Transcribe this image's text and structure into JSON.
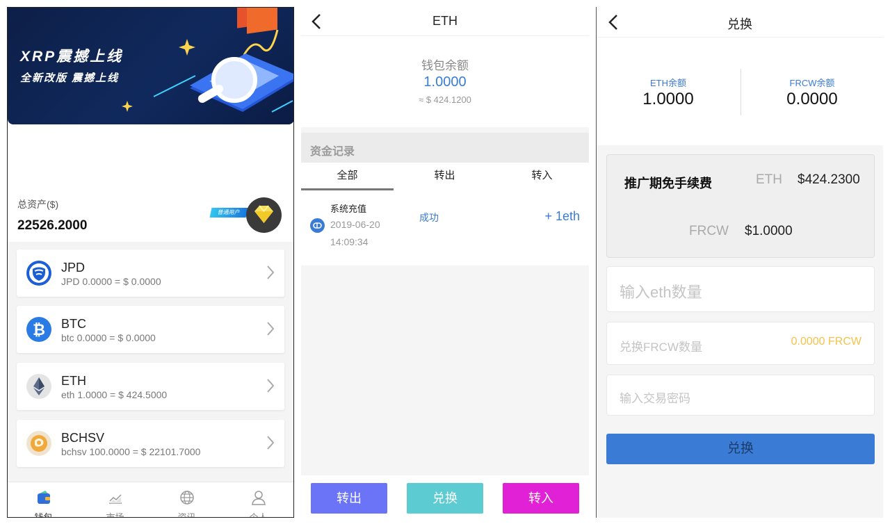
{
  "wallet": {
    "banner_title": "XRP震撼上线",
    "banner_subtitle": "全新改版  震撼上线",
    "total_assets_label": "总资产($)",
    "total_assets_value": "22526.2000",
    "user_badge": "普通用户",
    "coins": [
      {
        "name": "JPD",
        "detail": "JPD 0.0000 = $ 0.0000",
        "icon": "jpd-icon"
      },
      {
        "name": "BTC",
        "detail": "btc 0.0000 = $ 0.0000",
        "icon": "bitcoin-icon"
      },
      {
        "name": "ETH",
        "detail": "eth 1.0000 = $ 424.5000",
        "icon": "ethereum-icon"
      },
      {
        "name": "BCHSV",
        "detail": "bchsv 100.0000 = $ 22101.7000",
        "icon": "bchsv-icon"
      }
    ],
    "tabs": [
      {
        "label": "钱包",
        "icon": "wallet-icon"
      },
      {
        "label": "市场",
        "icon": "chart-icon"
      },
      {
        "label": "资讯",
        "icon": "globe-icon"
      },
      {
        "label": "个人",
        "icon": "user-icon"
      }
    ]
  },
  "eth": {
    "title": "ETH",
    "balance_label": "钱包余额",
    "balance_value": "1.0000",
    "balance_usd": "≈ $ 424.1200",
    "records_title": "资金记录",
    "record_tabs": [
      "全部",
      "转出",
      "转入"
    ],
    "records": [
      {
        "title": "系统充值",
        "date": "2019-06-20",
        "time": "14:09:34",
        "status": "成功",
        "amount": "+ 1eth"
      }
    ],
    "buttons": {
      "send": "转出",
      "exchange": "兑换",
      "receive": "转入"
    },
    "colors": {
      "send": "#6b74f7",
      "exchange": "#5ccbd2",
      "receive": "#e021d6",
      "accent": "#3a7bd5"
    }
  },
  "exchange": {
    "title": "兑换",
    "eth_balance_label": "ETH余额",
    "eth_balance_value": "1.0000",
    "frcw_balance_label": "FRCW余额",
    "frcw_balance_value": "0.0000",
    "promo_title": "推广期免手续费",
    "eth_price_label": "ETH",
    "eth_price_value": "$424.2300",
    "frcw_price_label": "FRCW",
    "frcw_price_value": "$1.0000",
    "amount_placeholder": "输入eth数量",
    "frcw_amount_label": "兑换FRCW数量",
    "frcw_amount_value": "0.0000 FRCW",
    "password_placeholder": "输入交易密码",
    "submit_label": "兑换"
  }
}
